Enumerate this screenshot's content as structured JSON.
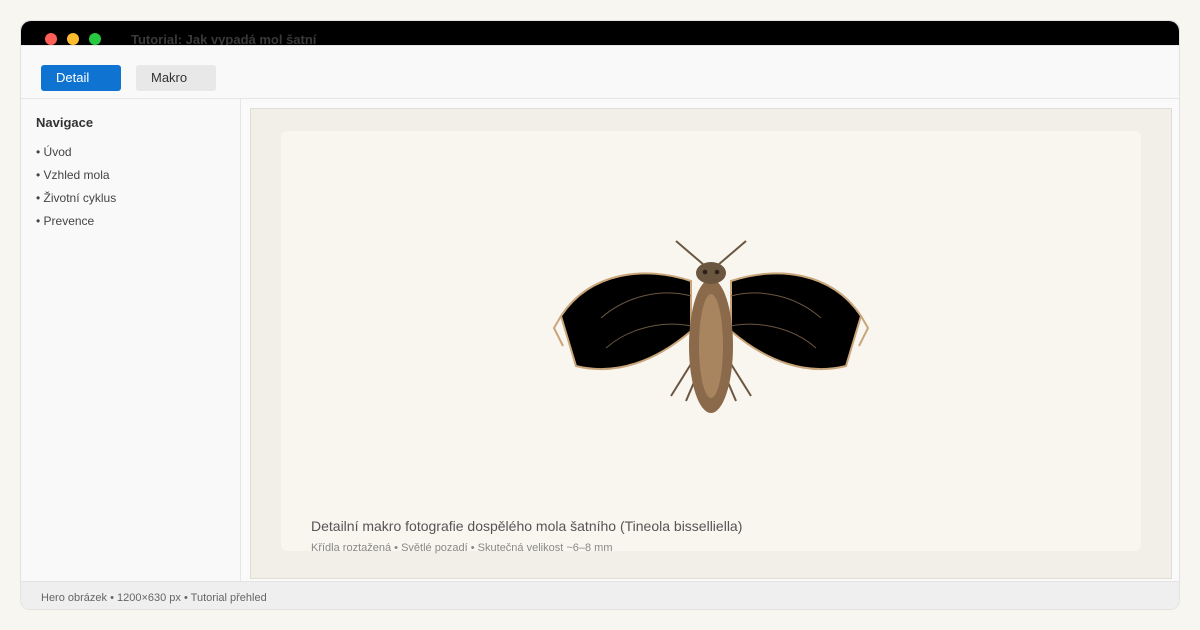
{
  "window": {
    "title": "Tutorial: Jak vypadá mol šatní"
  },
  "toolbar": {
    "tabs": [
      "Detail",
      "Makro"
    ]
  },
  "sidebar": {
    "title": "Navigace",
    "items": [
      "• Úvod",
      "• Vzhled mola",
      "• Životní cyklus",
      "• Prevence"
    ]
  },
  "main": {
    "caption": "Detailní makro fotografie dospělého mola šatního (Tineola bisselliella)",
    "subcaption": "Křídla roztažená • Světlé pozadí • Skutečná velikost ~6–8 mm"
  },
  "status": {
    "text": "Hero obrázek • 1200×630 px • Tutorial přehled"
  },
  "colors": {
    "accent": "#0f74d1",
    "wing": "#000000",
    "body": "#8a6a4a",
    "wing_outline": "#c9a57a"
  }
}
